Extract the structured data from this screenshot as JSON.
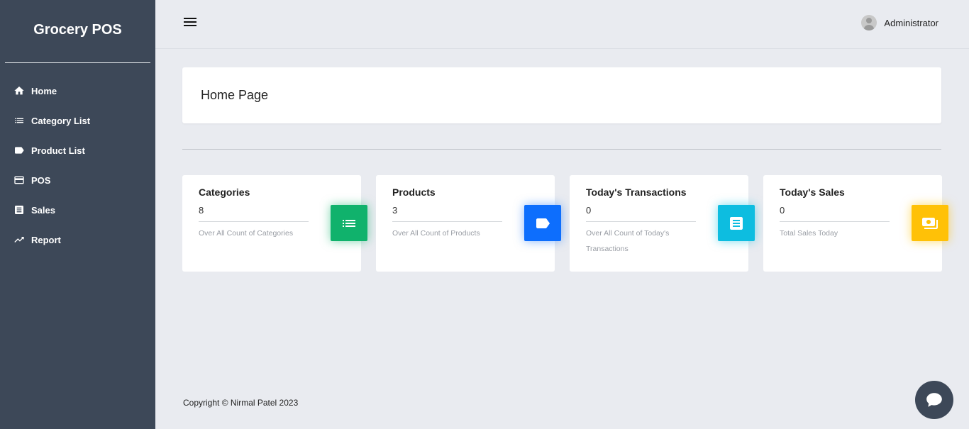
{
  "app": {
    "title": "Grocery POS"
  },
  "sidebar": {
    "items": [
      {
        "label": "Home",
        "icon": "home-icon"
      },
      {
        "label": "Category List",
        "icon": "list-icon"
      },
      {
        "label": "Product List",
        "icon": "tag-icon"
      },
      {
        "label": "POS",
        "icon": "credit-card-icon"
      },
      {
        "label": "Sales",
        "icon": "receipt-icon"
      },
      {
        "label": "Report",
        "icon": "trending-up-icon"
      }
    ]
  },
  "header": {
    "user_name": "Administrator"
  },
  "main": {
    "page_title": "Home Page",
    "cards": [
      {
        "title": "Categories",
        "value": "8",
        "description": "Over All Count of Categories",
        "icon": "list-icon",
        "color": "#10b26c"
      },
      {
        "title": "Products",
        "value": "3",
        "description": "Over All Count of Products",
        "icon": "tag-icon",
        "color": "#0d6efd"
      },
      {
        "title": "Today's Transactions",
        "value": "0",
        "description": "Over All Count of Today's Transactions",
        "icon": "receipt-icon",
        "color": "#0dbde0"
      },
      {
        "title": "Today's Sales",
        "value": "0",
        "description": "Total Sales Today",
        "icon": "money-icon",
        "color": "#ffc107"
      }
    ]
  },
  "footer": {
    "copyright": "Copyright © Nirmal Patel 2023"
  },
  "colors": {
    "sidebar_bg": "#3d4858",
    "page_bg": "#e9ebf0"
  }
}
